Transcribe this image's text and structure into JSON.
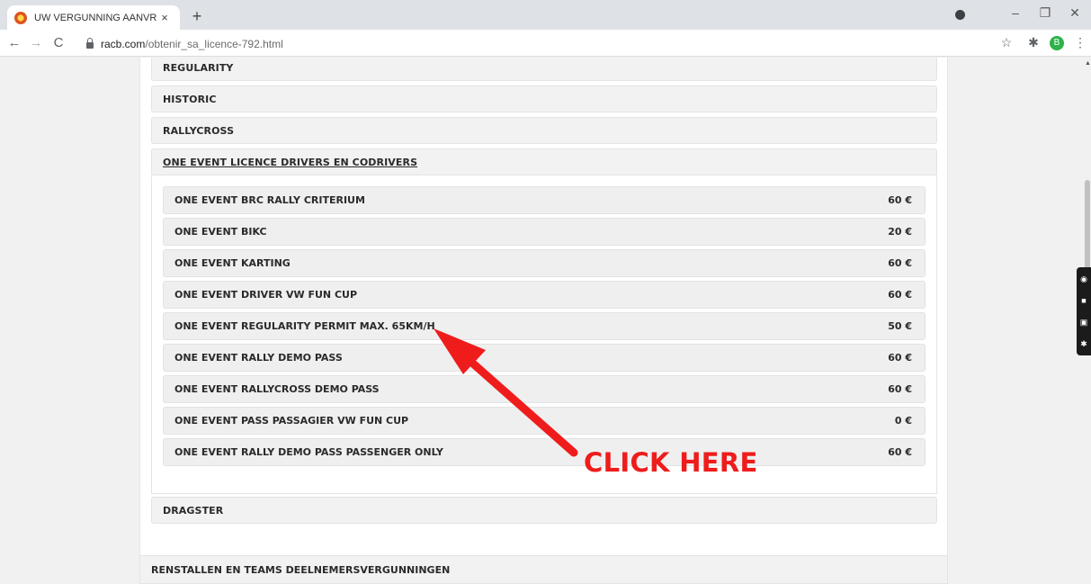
{
  "browser": {
    "tab_title": "UW VERGUNNING AANVRAGEN",
    "tab_close": "×",
    "new_tab": "+",
    "url_host": "racb.com",
    "url_path": "/obtenir_sa_licence-792.html",
    "profile_initial": "B",
    "icons": {
      "back": "←",
      "forward": "→",
      "reload": "C",
      "star": "☆",
      "extensions": "✱",
      "menu": "⋮",
      "minimize": "–",
      "restore": "❐",
      "close": "✕"
    }
  },
  "sections": {
    "regularity": "REGULARITY",
    "historic": "HISTORIC",
    "rallycross": "RALLYCROSS",
    "one_event": "ONE EVENT LICENCE DRIVERS EN CODRIVERS",
    "dragster": "DRAGSTER",
    "renstallen": "RENSTALLEN EN TEAMS DEELNEMERSVERGUNNINGEN"
  },
  "items": [
    {
      "name": "ONE EVENT BRC RALLY CRITERIUM",
      "price": "60 €"
    },
    {
      "name": "ONE EVENT BIKC",
      "price": "20 €"
    },
    {
      "name": "ONE EVENT KARTING",
      "price": "60 €"
    },
    {
      "name": "ONE EVENT DRIVER VW FUN CUP",
      "price": "60 €"
    },
    {
      "name": "ONE EVENT REGULARITY PERMIT MAX. 65KM/H",
      "price": "50 €"
    },
    {
      "name": "ONE EVENT RALLY DEMO PASS",
      "price": "60 €"
    },
    {
      "name": "ONE EVENT RALLYCROSS DEMO PASS",
      "price": "60 €"
    },
    {
      "name": "ONE EVENT PASS PASSAGIER VW FUN CUP",
      "price": "0 €"
    },
    {
      "name": "ONE EVENT RALLY DEMO PASS PASSENGER ONLY",
      "price": "60 €"
    }
  ],
  "annotation": {
    "text": "CLICK HERE",
    "color": "#ef1c1c"
  }
}
